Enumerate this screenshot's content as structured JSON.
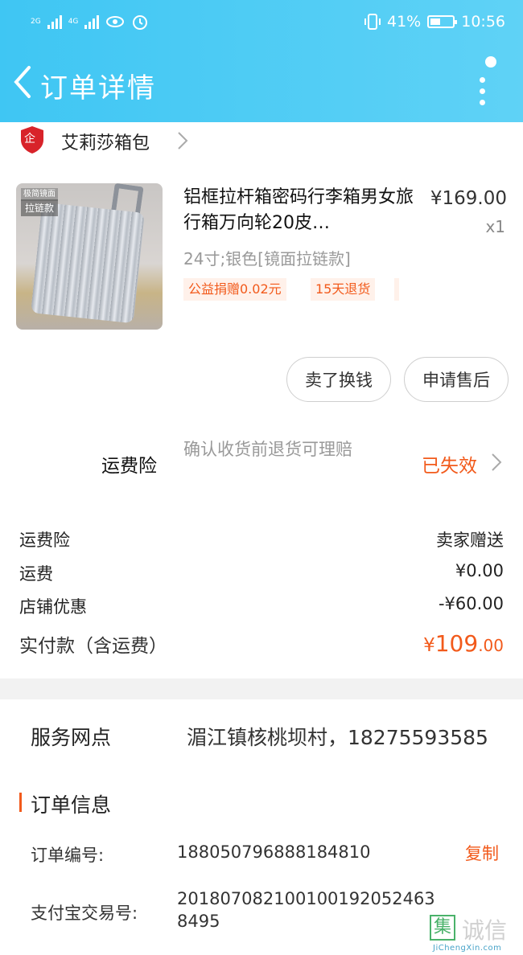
{
  "status_bar": {
    "sig1": "2G",
    "sig2": "4G",
    "battery_text": "41%",
    "time": "10:56"
  },
  "nav": {
    "title": "订单详情"
  },
  "store": {
    "logo_text": "企",
    "name": "艾莉莎箱包"
  },
  "product": {
    "image_tag_top": "极简镜面",
    "image_tag_bottom": "拉链款",
    "title": "铝框拉杆箱密码行李箱男女旅行箱万向轮20皮…",
    "price": "¥169.00",
    "qty": "x1",
    "spec": "24寸;银色[镜面拉链款]",
    "tags": [
      "公益捐赠0.02元",
      "15天退货"
    ]
  },
  "actions": {
    "sell": "卖了换钱",
    "after_sale": "申请售后"
  },
  "insurance": {
    "label": "运费险",
    "desc": "确认收货前退货可理赔",
    "status": "已失效"
  },
  "costs": [
    {
      "label": "运费险",
      "value": "卖家赠送"
    },
    {
      "label": "运费",
      "value": "¥0.00"
    },
    {
      "label": "店铺优惠",
      "value": "-¥60.00"
    }
  ],
  "total": {
    "label": "实付款（含运费）",
    "currency": "¥",
    "integer": "109",
    "decimal": ".00"
  },
  "service": {
    "label": "服务网点",
    "value": "湄江镇核桃坝村，18275593585"
  },
  "order_info": {
    "title": "订单信息",
    "order_no_label": "订单编号:",
    "order_no": "1880507968881848​10",
    "copy": "复制",
    "alipay_label": "支付宝交易号:",
    "alipay_no_line1": "20180708210010019205​2463",
    "alipay_no_line2": "8495"
  },
  "watermark": {
    "box": "集",
    "text": "诚信",
    "sub": "JiChengXin.com"
  },
  "colors": {
    "header": "#3fc6f3",
    "accent": "#f25a1b"
  }
}
